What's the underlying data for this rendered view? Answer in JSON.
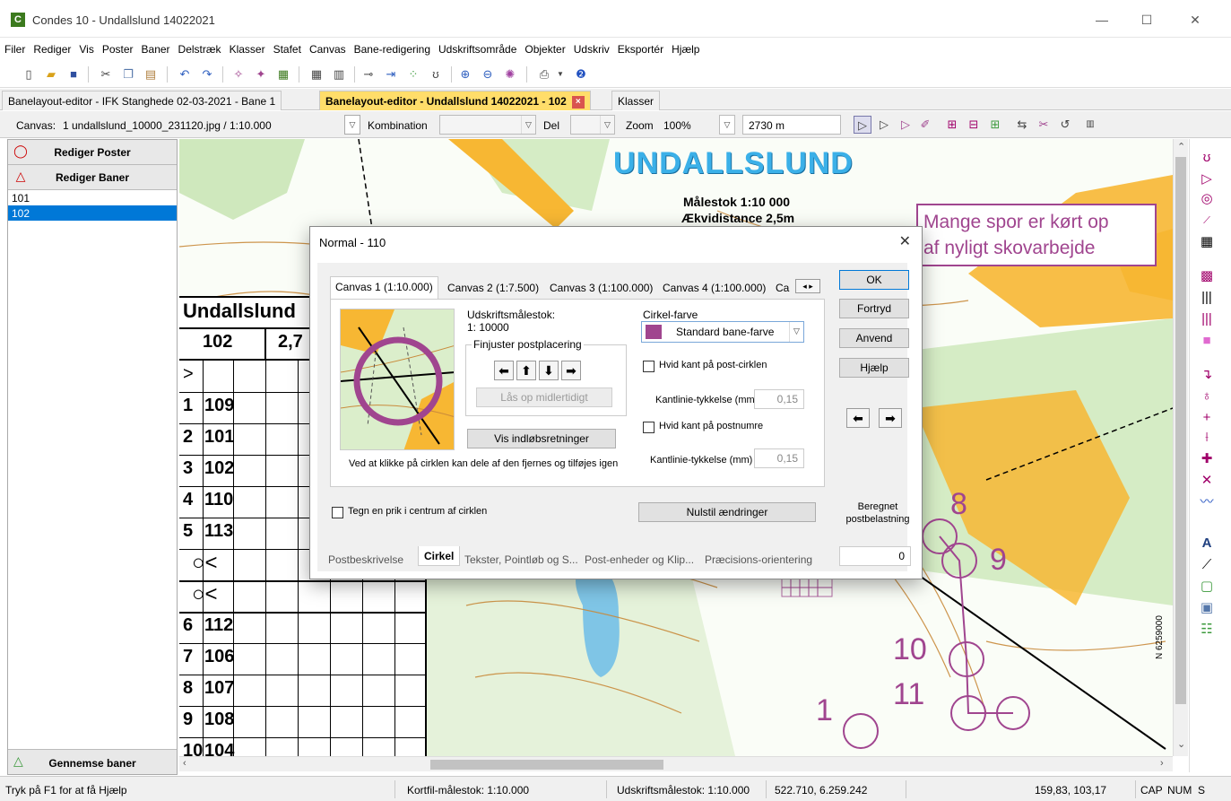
{
  "window": {
    "title": "Condes 10 - Undallslund 14022021",
    "app_icon_letter": "C",
    "minimize": "—",
    "maximize": "☐",
    "close": "✕"
  },
  "menu": [
    "Filer",
    "Rediger",
    "Vis",
    "Poster",
    "Baner",
    "Delstræk",
    "Klasser",
    "Stafet",
    "Canvas",
    "Bane-redigering",
    "Udskriftsområde",
    "Objekter",
    "Udskriv",
    "Eksportér",
    "Hjælp"
  ],
  "tabs": {
    "tab1": "Banelayout-editor - IFK Stanghede 02-03-2021 - Bane 1",
    "tab2": "Banelayout-editor - Undallslund 14022021 - 102",
    "tab2_close": "×",
    "tab3": "Klasser"
  },
  "options": {
    "canvas_label": "Canvas:",
    "canvas_value": "1 undallslund_10000_231120.jpg  / 1:10.000",
    "kombination_label": "Kombination",
    "del_label": "Del",
    "zoom_label": "Zoom",
    "zoom_value": "100%",
    "distance_value": "2730 m"
  },
  "left_panel": {
    "rediger_poster": "Rediger Poster",
    "rediger_baner": "Rediger Baner",
    "courses": [
      "101",
      "102"
    ],
    "gennemse_baner": "Gennemse baner"
  },
  "map": {
    "title": "UNDALLSLUND",
    "scale": "Målestok 1:10 000",
    "equidistance": "Ækvidistance 2,5m",
    "note_line1": "Mange spor er kørt op",
    "note_line2": "af nyligt skovarbejde",
    "desc_title": "Undallslund",
    "desc_course": "102",
    "desc_length": "2,7",
    "rows": [
      {
        "n": "1",
        "code": "109"
      },
      {
        "n": "2",
        "code": "101"
      },
      {
        "n": "3",
        "code": "102"
      },
      {
        "n": "4",
        "code": "110"
      },
      {
        "n": "5",
        "code": "113"
      },
      {
        "n": "6",
        "code": "112"
      },
      {
        "n": "7",
        "code": "106"
      },
      {
        "n": "8",
        "code": "107"
      },
      {
        "n": "9",
        "code": "108"
      },
      {
        "n": "10",
        "code": "104"
      }
    ],
    "control_numbers": [
      "8",
      "9",
      "10",
      "11",
      "1"
    ],
    "coord_label": "N 6259000"
  },
  "dialog": {
    "title": "Normal - 110",
    "close": "✕",
    "inner_tabs": [
      "Canvas 1  (1:10.000)",
      "Canvas 2  (1:7.500)",
      "Canvas 3  (1:100.000)",
      "Canvas 4  (1:100.000)",
      "Ca"
    ],
    "udskrift_label": "Udskriftsmålestok:",
    "udskrift_value": "1: 10000",
    "finjuster_label": "Finjuster postplacering",
    "laas_button": "Lås op midlertidigt",
    "vis_button": "Vis indløbsretninger",
    "hint": "Ved at klikke på cirklen kan dele af den fjernes og tilføjes igen",
    "cirkel_farve_label": "Cirkel-farve",
    "cirkel_farve_value": "Standard bane-farve",
    "hvid_kant_post": "Hvid kant på post-cirklen",
    "kantlinie_label": "Kantlinie-tykkelse (mm)",
    "kantlinie_value1": "0,15",
    "hvid_kant_numre": "Hvid kant på postnumre",
    "kantlinie_value2": "0,15",
    "tegn_prik": "Tegn en prik i centrum af cirklen",
    "nulstil": "Nulstil ændringer",
    "beregnet_line1": "Beregnet",
    "beregnet_line2": "postbelastning",
    "beregnet_value": "0",
    "ok": "OK",
    "fortryd": "Fortryd",
    "anvend": "Anvend",
    "hjaelp": "Hjælp",
    "bottom_tabs": [
      "Postbeskrivelse",
      "Cirkel",
      "Tekster, Pointløb og S...",
      "Post-enheder og Klip...",
      "Præcisions-orientering"
    ],
    "circle_color": "#a0458f"
  },
  "status": {
    "help": "Tryk på F1 for at få Hjælp",
    "kortfil": "Kortfil-målestok: 1:10.000",
    "udskrift": "Udskriftsmålestok: 1:10.000",
    "coords": "522.710, 6.259.242",
    "cursor": "159,83, 103,17",
    "cap": "CAP",
    "num": "NUM",
    "s": "S"
  },
  "colors": {
    "active_tab": "#ffdd6a",
    "selection": "#0078d7",
    "course_purple": "#a0458f",
    "map_orange": "#f7b733",
    "map_green": "#bfe0a8"
  }
}
